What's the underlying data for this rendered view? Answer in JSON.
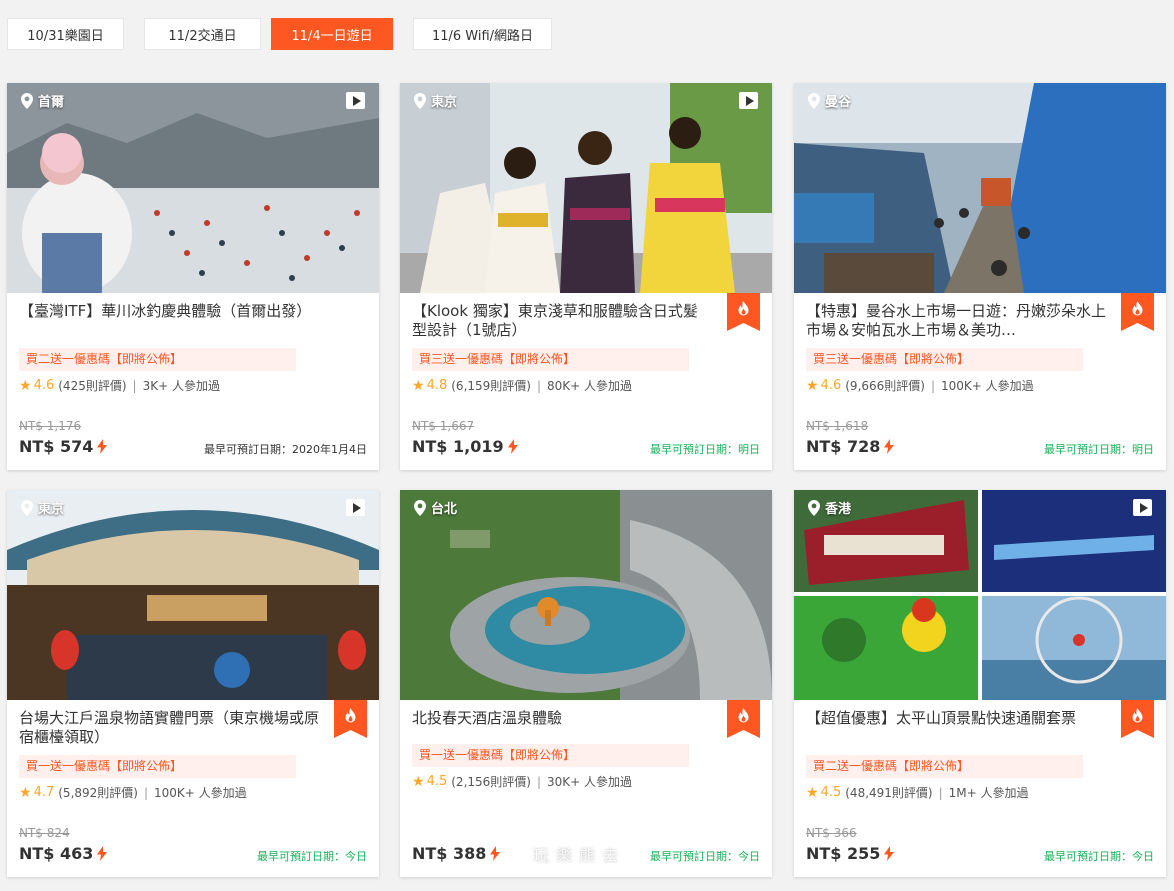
{
  "tabs": [
    {
      "label": "10/31樂園日",
      "active": false
    },
    {
      "label": "11/2交通日",
      "active": false
    },
    {
      "label": "11/4一日遊日",
      "active": true
    },
    {
      "label": "11/6 Wifi/網路日",
      "active": false
    }
  ],
  "colors": {
    "accent": "#ff5722",
    "star": "#ffa628",
    "available": "#16b05a"
  },
  "cards": [
    {
      "location": "首爾",
      "title": "【臺灣ITF】華川冰釣慶典體驗（首爾出發）",
      "promo": "買二送一優惠碼【即將公佈】",
      "score": "4.6",
      "reviews": "(425則評價)",
      "joined": "3K+ 人參加過",
      "old_price": "NT$ 1,176",
      "price": "NT$ 574",
      "availability": "最早可預訂日期：2020年1月4日",
      "video": true,
      "hot": false
    },
    {
      "location": "東京",
      "title": "【Klook 獨家】東京淺草和服體驗含日式髮型設計（1號店）",
      "promo": "買三送一優惠碼【即將公佈】",
      "score": "4.8",
      "reviews": "(6,159則評價)",
      "joined": "80K+ 人參加過",
      "old_price": "NT$ 1,667",
      "price": "NT$ 1,019",
      "availability": "最早可預訂日期：明日",
      "video": true,
      "hot": true
    },
    {
      "location": "曼谷",
      "title": "【特惠】曼谷水上市場一日遊：丹嫩莎朵水上市場＆安帕瓦水上市場＆美功…",
      "promo": "買三送一優惠碼【即將公佈】",
      "score": "4.6",
      "reviews": "(9,666則評價)",
      "joined": "100K+ 人參加過",
      "old_price": "NT$ 1,618",
      "price": "NT$ 728",
      "availability": "最早可預訂日期：明日",
      "video": false,
      "hot": true
    },
    {
      "location": "東京",
      "title": "台場大江戶溫泉物語實體門票（東京機場或原宿櫃檯領取）",
      "promo": "買一送一優惠碼【即將公佈】",
      "score": "4.7",
      "reviews": "(5,892則評價)",
      "joined": "100K+ 人參加過",
      "old_price": "NT$ 824",
      "price": "NT$ 463",
      "availability": "最早可預訂日期：今日",
      "video": true,
      "hot": true
    },
    {
      "location": "台北",
      "title": "北投春天酒店溫泉體驗",
      "promo": "買一送一優惠碼【即將公佈】",
      "score": "4.5",
      "reviews": "(2,156則評價)",
      "joined": "30K+ 人參加過",
      "old_price": "",
      "price": "NT$ 388",
      "availability": "最早可預訂日期：今日",
      "video": false,
      "hot": true
    },
    {
      "location": "香港",
      "title": "【超值優惠】太平山頂景點快速通關套票",
      "promo": "買二送一優惠碼【即將公佈】",
      "score": "4.5",
      "reviews": "(48,491則評價)",
      "joined": "1M+ 人參加過",
      "old_price": "NT$ 366",
      "price": "NT$ 255",
      "availability": "最早可預訂日期：今日",
      "video": true,
      "hot": true
    }
  ],
  "watermark": "玩 樂 熊 去"
}
